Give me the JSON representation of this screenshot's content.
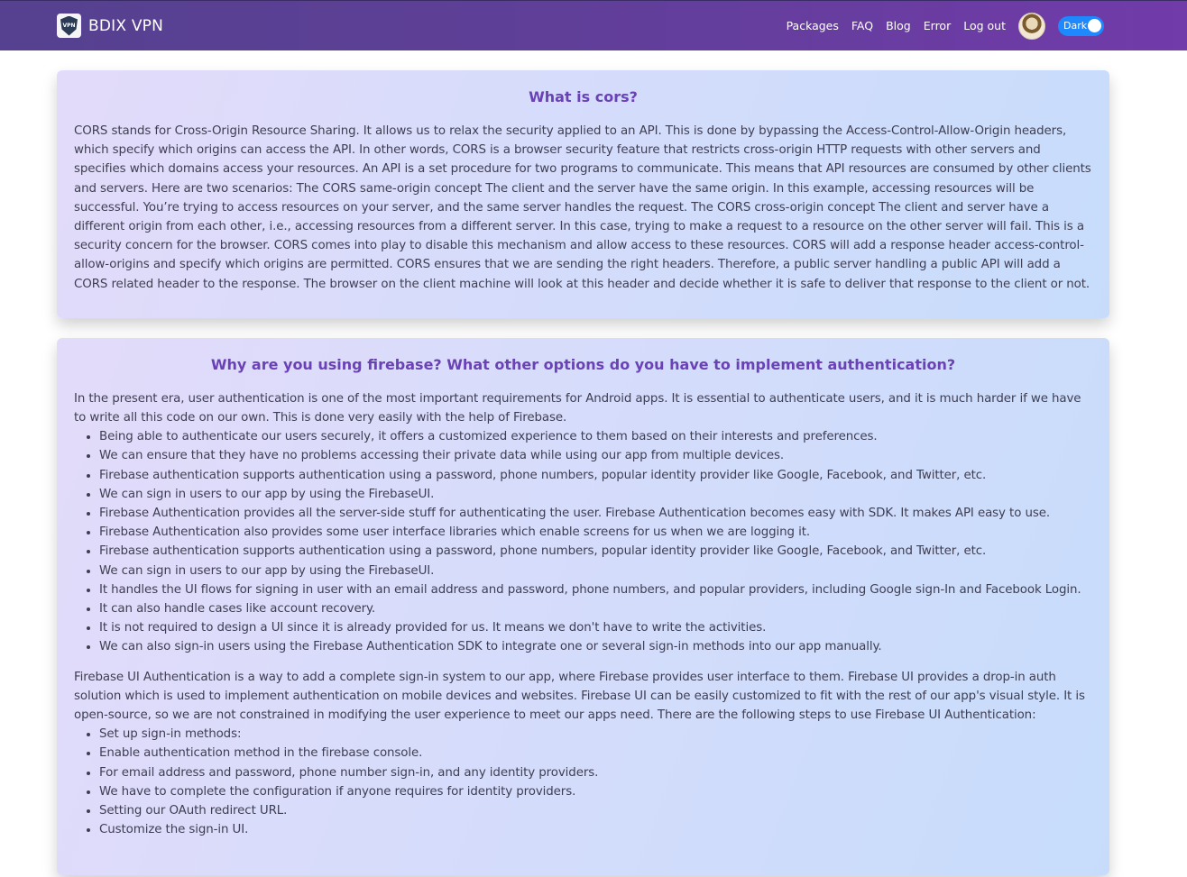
{
  "nav": {
    "brand": "BDIX VPN",
    "logo_text": "VPN",
    "links": [
      "Packages",
      "FAQ",
      "Blog",
      "Error",
      "Log out"
    ],
    "theme_toggle_label": "Dark"
  },
  "cards": [
    {
      "title": "What is cors?",
      "paragraph": "CORS stands for Cross-Origin Resource Sharing. It allows us to relax the security applied to an API. This is done by bypassing the Access-Control-Allow-Origin headers, which specify which origins can access the API. In other words, CORS is a browser security feature that restricts cross-origin HTTP requests with other servers and specifies which domains access your resources. An API is a set procedure for two programs to communicate. This means that API resources are consumed by other clients and servers. Here are two scenarios: The CORS same-origin concept The client and the server have the same origin. In this example, accessing resources will be successful. You’re trying to access resources on your server, and the same server handles the request. The CORS cross-origin concept The client and server have a different origin from each other, i.e., accessing resources from a different server. In this case, trying to make a request to a resource on the other server will fail. This is a security concern for the browser. CORS comes into play to disable this mechanism and allow access to these resources. CORS will add a response header access-control-allow-origins and specify which origins are permitted. CORS ensures that we are sending the right headers. Therefore, a public server handling a public API will add a CORS related header to the response. The browser on the client machine will look at this header and decide whether it is safe to deliver that response to the client or not."
    },
    {
      "title": "Why are you using firebase? What other options do you have to implement authentication?",
      "intro": "In the present era, user authentication is one of the most important requirements for Android apps. It is essential to authenticate users, and it is much harder if we have to write all this code on our own. This is done very easily with the help of Firebase.",
      "list1": [
        "Being able to authenticate our users securely, it offers a customized experience to them based on their interests and preferences.",
        "We can ensure that they have no problems accessing their private data while using our app from multiple devices.",
        "Firebase authentication supports authentication using a password, phone numbers, popular identity provider like Google, Facebook, and Twitter, etc.",
        "We can sign in users to our app by using the FirebaseUI.",
        "Firebase Authentication provides all the server-side stuff for authenticating the user. Firebase Authentication becomes easy with SDK. It makes API easy to use.",
        "Firebase Authentication also provides some user interface libraries which enable screens for us when we are logging it.",
        "Firebase authentication supports authentication using a password, phone numbers, popular identity provider like Google, Facebook, and Twitter, etc.",
        "We can sign in users to our app by using the FirebaseUI.",
        "It handles the UI flows for signing in user with an email address and password, phone numbers, and popular providers, including Google sign-In and Facebook Login.",
        "It can also handle cases like account recovery.",
        "It is not required to design a UI since it is already provided for us. It means we don't have to write the activities.",
        "We can also sign-in users using the Firebase Authentication SDK to integrate one or several sign-in methods into our app manually."
      ],
      "para2": "Firebase UI Authentication is a way to add a complete sign-in system to our app, where Firebase provides user interface to them. Firebase UI provides a drop-in auth solution which is used to implement authentication on mobile devices and websites. Firebase UI can be easily customized to fit with the rest of our app's visual style. It is open-source, so we are not constrained in modifying the user experience to meet our apps need. There are the following steps to use Firebase UI Authentication:",
      "list2": [
        "Set up sign-in methods:",
        "Enable authentication method in the firebase console.",
        "For email address and password, phone number sign-in, and any identity providers.",
        "We have to complete the configuration if anyone requires for identity providers.",
        "Setting our OAuth redirect URL.",
        "Customize the sign-in UI."
      ]
    }
  ]
}
